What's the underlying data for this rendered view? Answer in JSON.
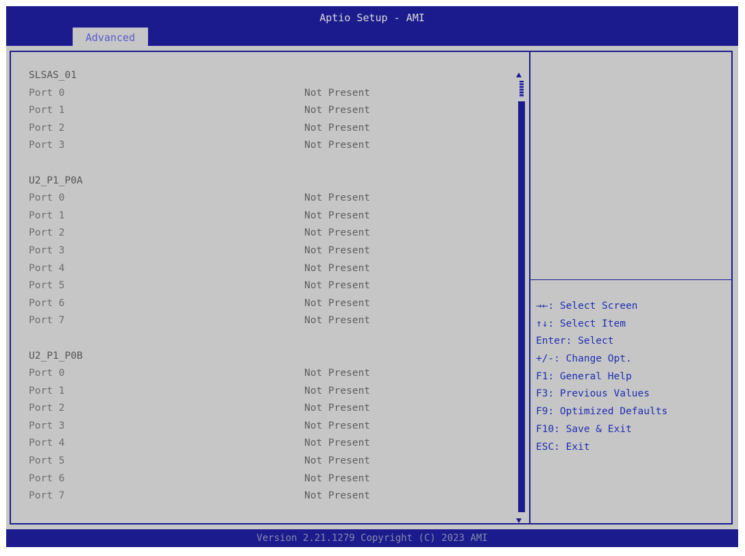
{
  "header": {
    "title": "Aptio Setup - AMI",
    "tab_label": "Advanced"
  },
  "groups": [
    {
      "name": "SLSAS_01",
      "ports": [
        {
          "label": "Port 0",
          "value": "Not Present"
        },
        {
          "label": "Port 1",
          "value": "Not Present"
        },
        {
          "label": "Port 2",
          "value": "Not Present"
        },
        {
          "label": "Port 3",
          "value": "Not Present"
        }
      ]
    },
    {
      "name": "U2_P1_P0A",
      "ports": [
        {
          "label": "Port 0",
          "value": "Not Present"
        },
        {
          "label": "Port 1",
          "value": "Not Present"
        },
        {
          "label": "Port 2",
          "value": "Not Present"
        },
        {
          "label": "Port 3",
          "value": "Not Present"
        },
        {
          "label": "Port 4",
          "value": "Not Present"
        },
        {
          "label": "Port 5",
          "value": "Not Present"
        },
        {
          "label": "Port 6",
          "value": "Not Present"
        },
        {
          "label": "Port 7",
          "value": "Not Present"
        }
      ]
    },
    {
      "name": "U2_P1_P0B",
      "ports": [
        {
          "label": "Port 0",
          "value": "Not Present"
        },
        {
          "label": "Port 1",
          "value": "Not Present"
        },
        {
          "label": "Port 2",
          "value": "Not Present"
        },
        {
          "label": "Port 3",
          "value": "Not Present"
        },
        {
          "label": "Port 4",
          "value": "Not Present"
        },
        {
          "label": "Port 5",
          "value": "Not Present"
        },
        {
          "label": "Port 6",
          "value": "Not Present"
        },
        {
          "label": "Port 7",
          "value": "Not Present"
        }
      ]
    }
  ],
  "help_keys": [
    "→←: Select Screen",
    "↑↓: Select Item",
    "Enter: Select",
    "+/-: Change Opt.",
    "F1: General Help",
    "F3: Previous Values",
    "F9: Optimized Defaults",
    "F10: Save & Exit",
    "ESC: Exit"
  ],
  "footer": {
    "version": "Version 2.21.1279 Copyright (C) 2023 AMI"
  },
  "colors": {
    "bar_blue": "#1b1b8e",
    "background_gray": "#c6c6c6",
    "help_text_blue": "#1f2fb0"
  },
  "icons": {
    "scroll_up": "scroll-up-arrow-icon",
    "scroll_down": "scroll-down-arrow-icon"
  }
}
